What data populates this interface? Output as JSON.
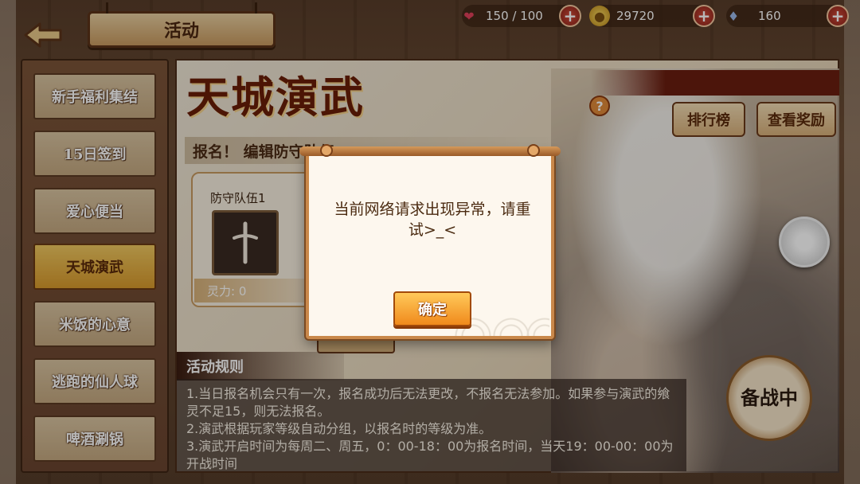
{
  "header": {
    "title": "活动"
  },
  "resources": [
    {
      "icon": "heart-icon",
      "value": "150 / 100"
    },
    {
      "icon": "coin-icon",
      "value": "29720"
    },
    {
      "icon": "crystal-icon",
      "value": "160"
    }
  ],
  "sidebar": {
    "items": [
      {
        "label": "新手福利集结"
      },
      {
        "label": "15日签到"
      },
      {
        "label": "爱心便当"
      },
      {
        "label": "天城演武",
        "active": true
      },
      {
        "label": "米饭的心意"
      },
      {
        "label": "逃跑的仙人球"
      },
      {
        "label": "啤酒涮锅"
      }
    ]
  },
  "main": {
    "event_title": "天城演武",
    "ranking_button": "排行榜",
    "rewards_button": "查看奖励",
    "signup_text": "报名！ 编辑防守队伍",
    "team": {
      "name": "防守队伍1",
      "power": "灵力: 0"
    },
    "rules_title": "活动规则",
    "rules_text": "1.当日报名机会只有一次，报名成功后无法更改，不报名无法参加。如果参与演武的飨灵不足15，则无法报名。\n2.演武根据玩家等级自动分组，以报名时的等级为准。\n3.演武开启时间为每周二、周五，0：00-18：00为报名时间，当天19：00-00：00为开战时间",
    "battle_seal_text": "备战中"
  },
  "dialog": {
    "message": "当前网络请求出现异常，请重试>_<",
    "confirm_label": "确定"
  },
  "colors": {
    "accent": "#f08a1c",
    "dialog_border": "#c9884a",
    "active_menu": "#f0c860"
  }
}
